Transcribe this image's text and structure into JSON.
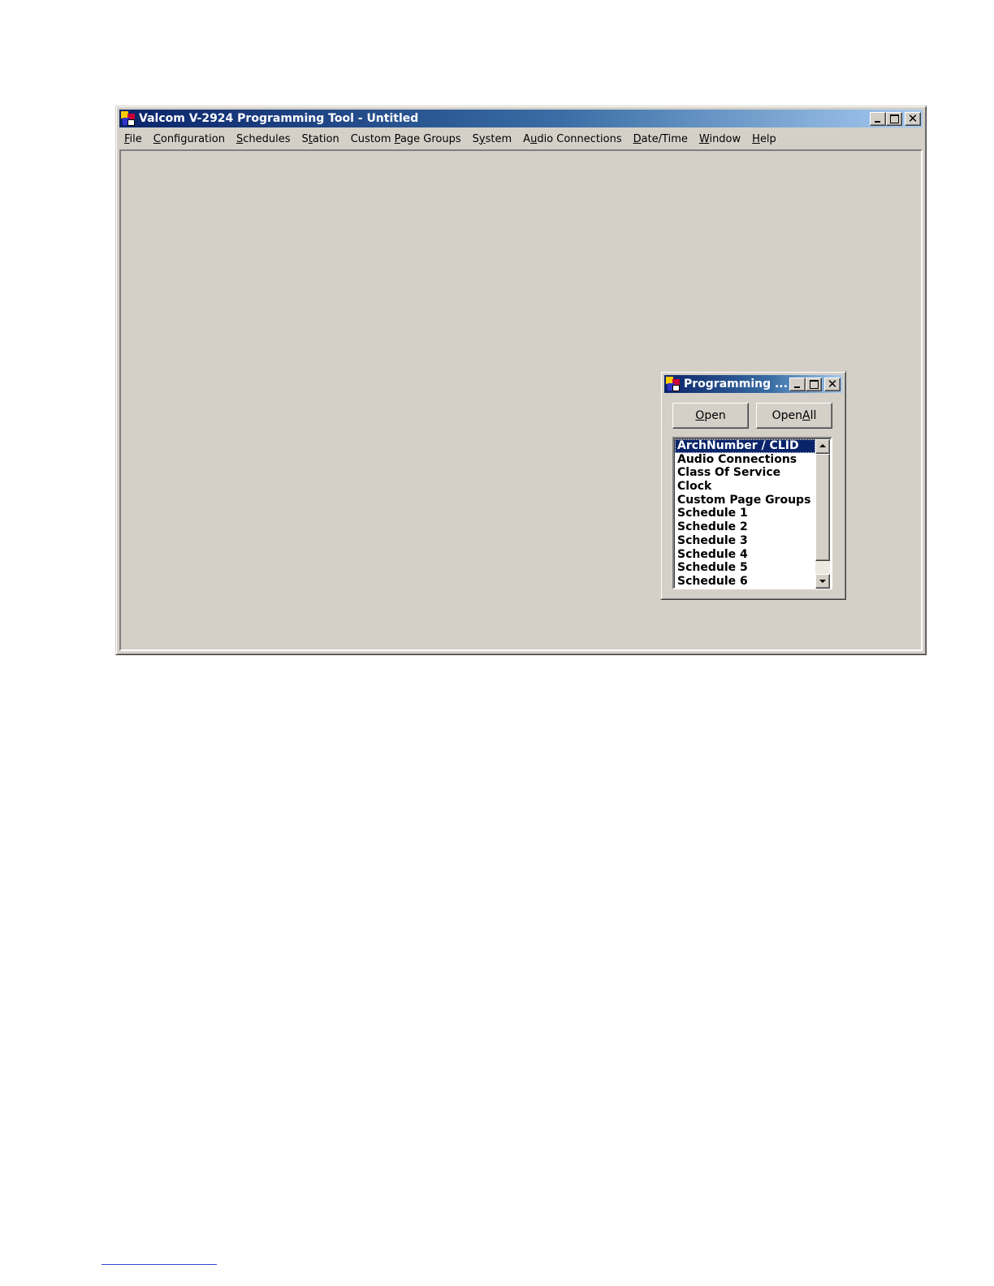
{
  "main_window": {
    "title": "Valcom V-2924 Programming Tool - Untitled",
    "menu": [
      {
        "pre": "",
        "key": "F",
        "post": "ile"
      },
      {
        "pre": "",
        "key": "C",
        "post": "onfiguration"
      },
      {
        "pre": "",
        "key": "S",
        "post": "chedules"
      },
      {
        "pre": "S",
        "key": "t",
        "post": "ation"
      },
      {
        "pre": "Custom ",
        "key": "P",
        "post": "age Groups"
      },
      {
        "pre": "S",
        "key": "y",
        "post": "stem"
      },
      {
        "pre": "A",
        "key": "u",
        "post": "dio Connections"
      },
      {
        "pre": "",
        "key": "D",
        "post": "ate/Time"
      },
      {
        "pre": "",
        "key": "W",
        "post": "indow"
      },
      {
        "pre": "",
        "key": "H",
        "post": "elp"
      }
    ],
    "caption_icons": [
      "minimize-icon",
      "maximize-icon",
      "close-icon"
    ]
  },
  "child_window": {
    "title": "Programming ...",
    "open_button": {
      "pre": "",
      "key": "O",
      "post": "pen"
    },
    "open_all_button": {
      "pre": "Open ",
      "key": "A",
      "post": "ll"
    },
    "list_items": [
      "ArchNumber / CLID",
      "Audio Connections",
      "Class Of Service",
      "Clock",
      "Custom Page Groups",
      "Schedule 1",
      "Schedule 2",
      "Schedule 3",
      "Schedule 4",
      "Schedule 5",
      "Schedule 6"
    ],
    "selected_index": 0
  },
  "colors": {
    "titlebar_active": "#0a246a",
    "window_face": "#d4d0c8",
    "selection": "#0a246a"
  }
}
